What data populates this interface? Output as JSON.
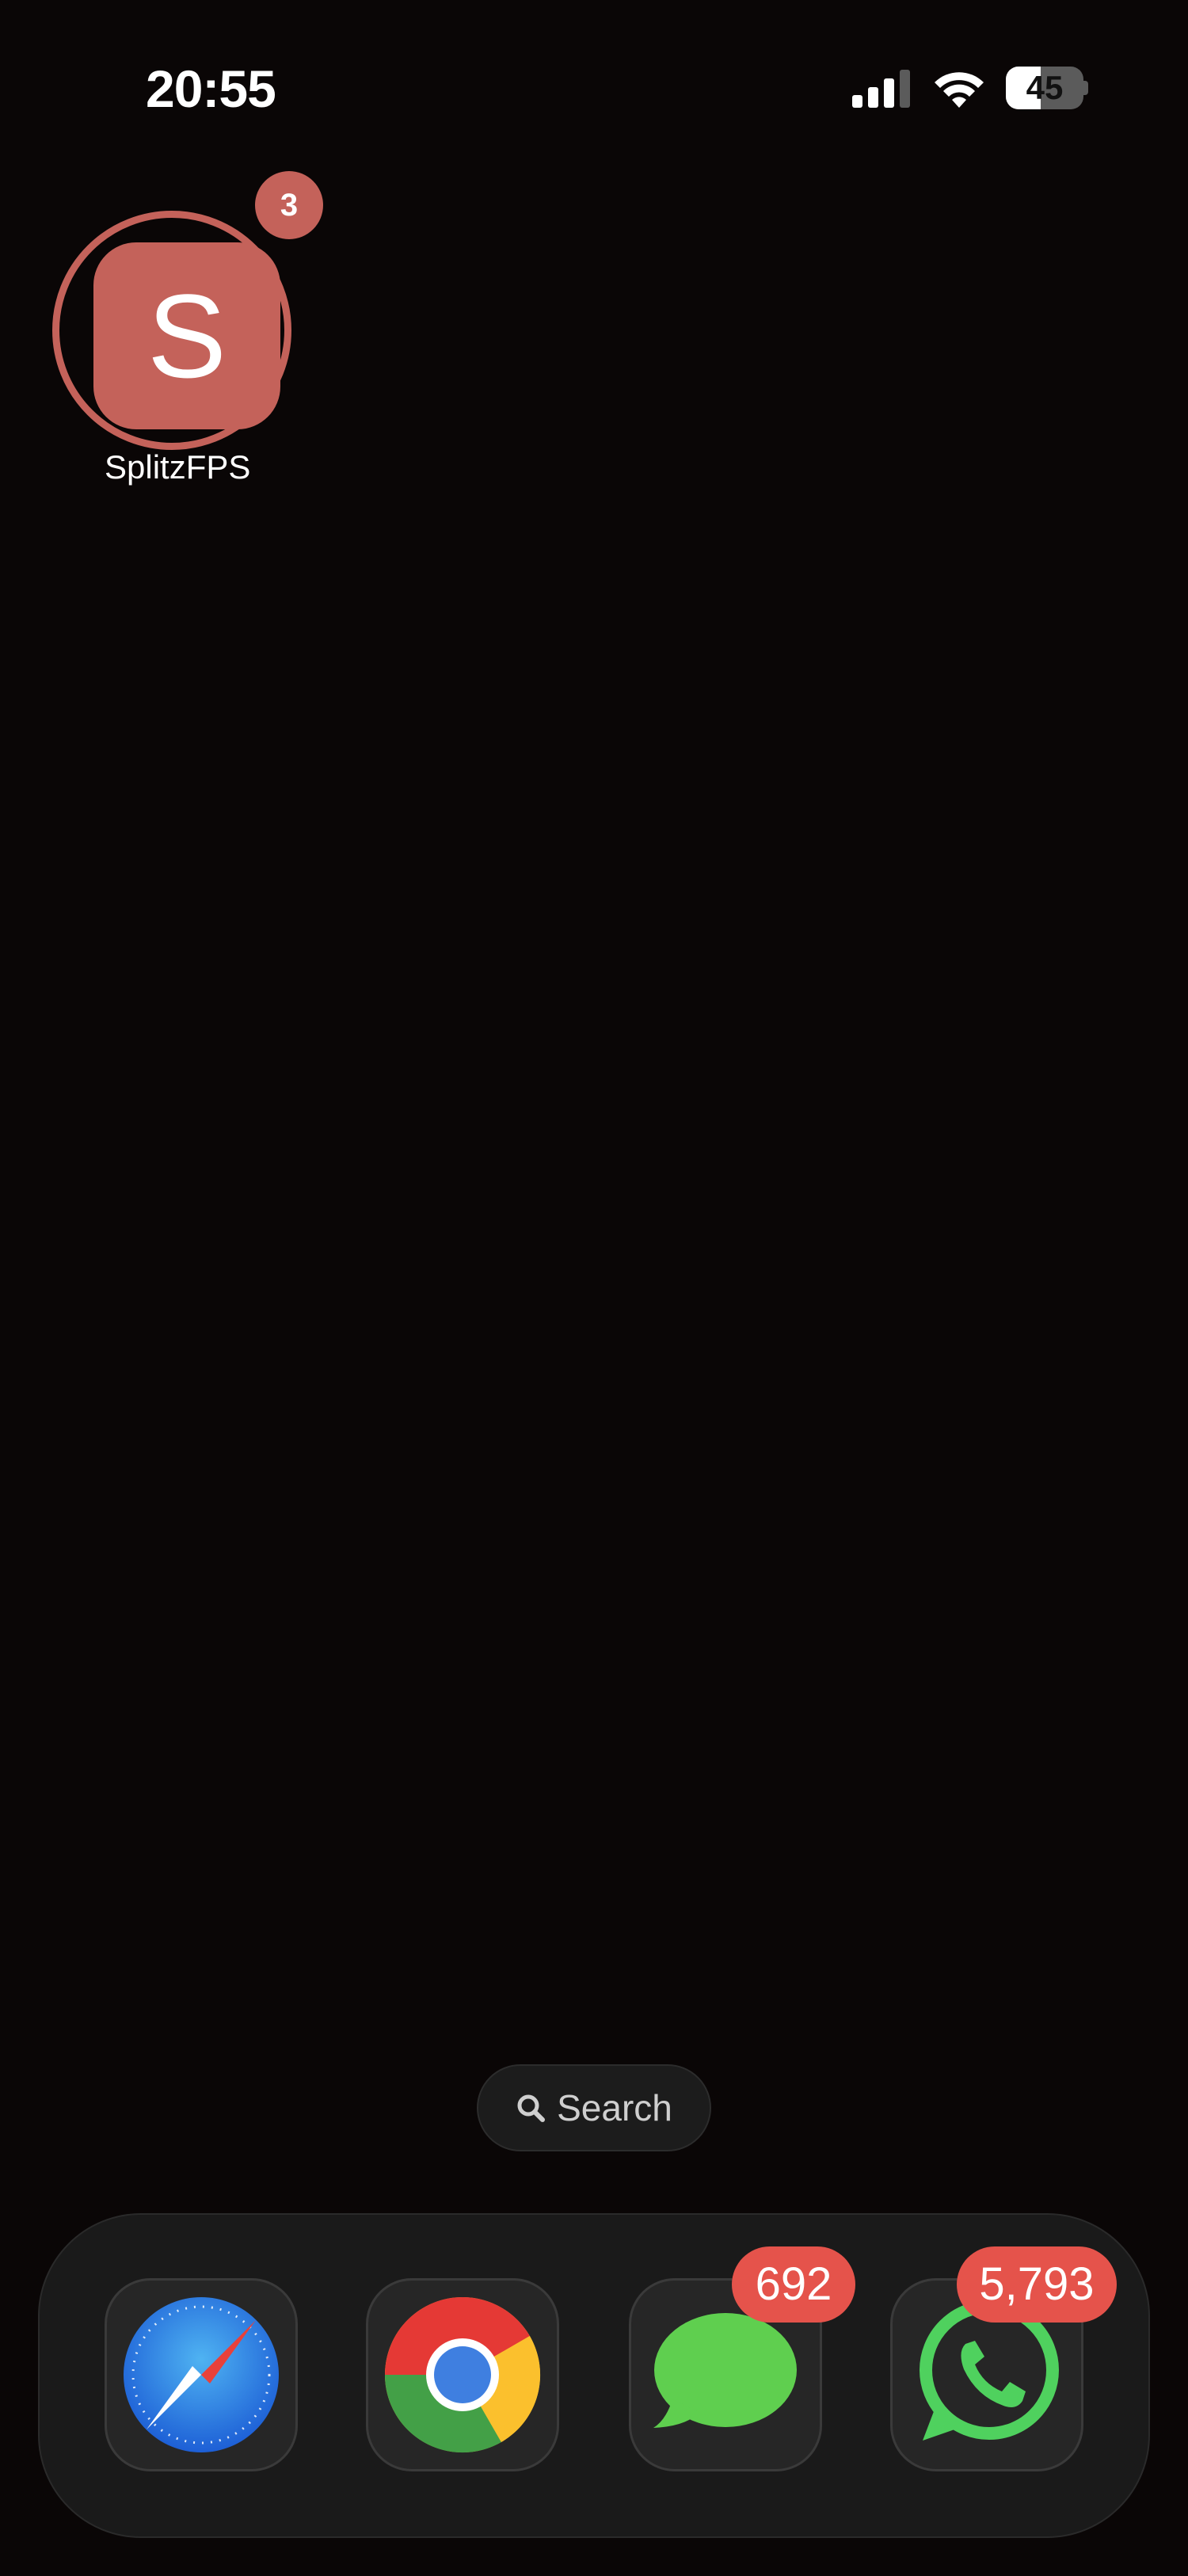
{
  "status_bar": {
    "time": "20:55",
    "battery_level": "45",
    "battery_fraction": 0.45,
    "signal_bars": 3
  },
  "home": {
    "apps": [
      {
        "label": "SplitzFPS",
        "letter": "S",
        "badge": "3",
        "color": "#c4625a",
        "icon": "letter-s-icon"
      }
    ]
  },
  "search": {
    "label": "Search",
    "icon": "search-icon"
  },
  "dock": {
    "apps": [
      {
        "name": "Safari",
        "icon": "safari-icon",
        "badge": ""
      },
      {
        "name": "Chrome",
        "icon": "chrome-icon",
        "badge": ""
      },
      {
        "name": "Messages",
        "icon": "messages-icon",
        "badge": "692"
      },
      {
        "name": "WhatsApp",
        "icon": "whatsapp-icon",
        "badge": "5,793"
      }
    ]
  },
  "colors": {
    "background": "#0a0606",
    "badge_red": "#e5534b",
    "app_accent": "#c4625a"
  }
}
